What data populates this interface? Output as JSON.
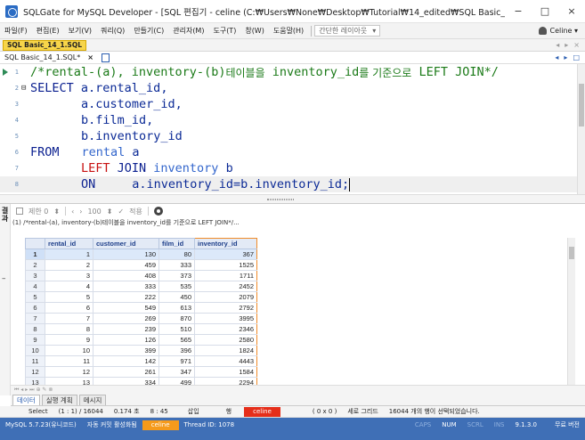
{
  "window": {
    "title": "SQLGate for MySQL Developer - [SQL 편집기 - celine (C:₩Users₩None₩Desktop₩Tutorial₩14_edited₩SQL Basic_14_1.SQL)]",
    "minimize": "−",
    "maximize": "□",
    "close": "×"
  },
  "menu": {
    "items": [
      "파일(F)",
      "편집(E)",
      "보기(V)",
      "쿼리(Q)",
      "만들기(C)",
      "관리자(M)",
      "도구(T)",
      "창(W)",
      "도움말(H)"
    ],
    "layout_label": "간단한 레이아웃",
    "user": "Celine ▾"
  },
  "doc_tab": {
    "label": "SQL Basic_14_1.SQL",
    "nav": [
      "◂",
      "▸",
      "×"
    ]
  },
  "editor_tab": {
    "label": "SQL Basic_14_1.SQL*",
    "close": "×",
    "right_controls": [
      "◂",
      "▸",
      "□"
    ]
  },
  "editor": {
    "line_numbers": [
      "1",
      "2",
      "3",
      "4",
      "5",
      "6",
      "7",
      "8"
    ],
    "line1_comment_a": "/*rental-(a), inventory-(b)",
    "line1_comment_b": "테이블을",
    "line1_comment_c": " inventory_id",
    "line1_comment_d": "를 기준으로",
    "line1_comment_e": " LEFT JOIN*/",
    "select_kw": "SELECT",
    "col1": " a.rental_id,",
    "col2": "a.customer_id,",
    "col3": "b.film_id,",
    "col4": "b.inventory_id",
    "from_kw": "FROM",
    "from_table": "rental",
    "from_alias": " a",
    "left_kw": "LEFT",
    "join_kw": " JOIN",
    "join_table": " inventory",
    "join_alias": " b",
    "on_kw": "ON",
    "on_cond": "a.inventory_id=b.inventory_id;"
  },
  "result_panel": {
    "side_label": "결과",
    "limit_label": "제한 0",
    "limit_value": "100",
    "apply_label": "적용",
    "query_label": "(1) /*rental-(a), inventory-(b)테이블을 inventory_id를 기준으로 LEFT JOIN*/..."
  },
  "grid": {
    "columns": [
      "rental_id",
      "customer_id",
      "film_id",
      "inventory_id"
    ],
    "rows": [
      [
        "1",
        "1",
        "130",
        "80",
        "367"
      ],
      [
        "2",
        "2",
        "459",
        "333",
        "1525"
      ],
      [
        "3",
        "3",
        "408",
        "373",
        "1711"
      ],
      [
        "4",
        "4",
        "333",
        "535",
        "2452"
      ],
      [
        "5",
        "5",
        "222",
        "450",
        "2079"
      ],
      [
        "6",
        "6",
        "549",
        "613",
        "2792"
      ],
      [
        "7",
        "7",
        "269",
        "870",
        "3995"
      ],
      [
        "8",
        "8",
        "239",
        "510",
        "2346"
      ],
      [
        "9",
        "9",
        "126",
        "565",
        "2580"
      ],
      [
        "10",
        "10",
        "399",
        "396",
        "1824"
      ],
      [
        "11",
        "11",
        "142",
        "971",
        "4443"
      ],
      [
        "12",
        "12",
        "261",
        "347",
        "1584"
      ],
      [
        "13",
        "13",
        "334",
        "499",
        "2294"
      ]
    ],
    "hscroll_nav": "⏮ ◂ ▸ ⏭ ⊕ ✎ ⊗"
  },
  "result_tabs": [
    "데이터",
    "실행 계획",
    "메시지"
  ],
  "info": {
    "mode": "Select",
    "position": "(1 : 1) / 16044",
    "elapsed": "0.174 초",
    "time": "8 : 45",
    "insert": "삽입",
    "page": "행",
    "user": "celine",
    "cursor": "( 0 x 0 )",
    "grid_mode": "세로 그리드",
    "rows_selected": "16044 개의 행이 선택되었습니다."
  },
  "status": {
    "server": "MySQL 5.7.23(유니코드)",
    "autocommit": "자동 커밋 활성화됨",
    "user": "celine",
    "thread": "Thread ID: 1078",
    "caps": "CAPS",
    "num": "NUM",
    "scrl": "SCRL",
    "ins": "INS",
    "version": "9.1.3.0",
    "license": "무료 버전"
  },
  "colors": {
    "statusbar": "#3f6fb6",
    "user_badge": "#e52e1a",
    "doc_tab": "#f7d54a",
    "keyword": "#0a1f8f",
    "comment": "#1b7a18",
    "column_highlight": "#f08c2a"
  }
}
